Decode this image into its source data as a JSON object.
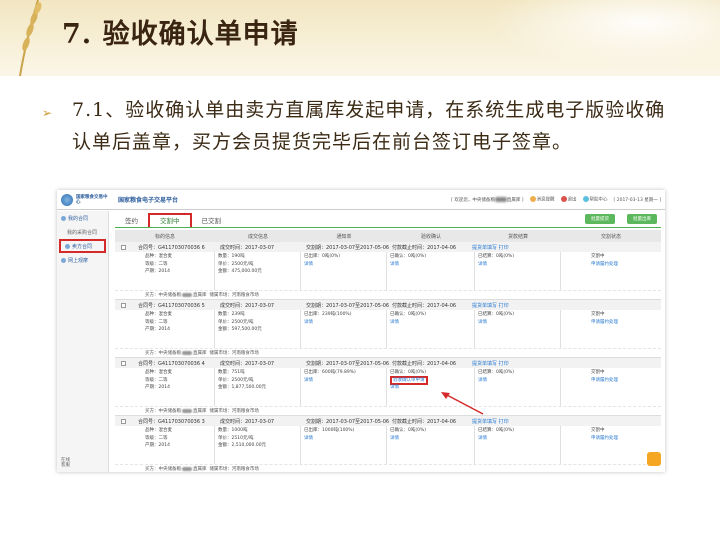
{
  "slide": {
    "title": "7. 验收确认单申请",
    "bullet": "7.1、验收确认单由卖方直属库发起申请，在系统生成电子版验收确认单后盖章，买方会员提货完毕后在前台签订电子签章。"
  },
  "app": {
    "logo_text": "国家粮食交易中心",
    "site_title": "国家粮食电子交易平台",
    "welcome_prefix": "[ 欢迎您，中央储备粮",
    "welcome_suffix": "直属库 ]",
    "messages": "消息提醒",
    "logout": "退出",
    "help": "帮助中心",
    "date": "[ 2017-03-13 星期一 ]"
  },
  "sidebar": {
    "items": [
      {
        "label": "我的合同"
      },
      {
        "label": "我的采购合同"
      },
      {
        "label": "卖方合同"
      },
      {
        "label": "网上观摩"
      }
    ],
    "footer": "在线客服"
  },
  "tabs": [
    {
      "label": "签约"
    },
    {
      "label": "交割中"
    },
    {
      "label": "已交割"
    }
  ],
  "buttons": {
    "btn1": "批量提货",
    "btn2": "批量出库"
  },
  "columns": [
    "标的信息",
    "成交信息",
    "通知单",
    "验收确认",
    "货款结算",
    "交割状态"
  ],
  "orders": [
    {
      "contract": "合同号：G411703070036 6",
      "deal_time": "成交时间：2017-03-07",
      "period": "交割期：2017-03-07至2017-05-06",
      "confirm_time": "付款截止时间：2017-04-06",
      "apply_link": "提货单填写",
      "print_link": "打印",
      "variety": "品种：混合麦",
      "grade": "等级：二等",
      "year": "产期：2014",
      "qty": "数量：190吨",
      "price": "单价：2500元/吨",
      "amount": "金额：475,000.00元",
      "notice": "已出库：0吨(0%)",
      "notice_link": "详情",
      "accept": "已确认：0吨(0%)",
      "accept_link": "详情",
      "pay": "已结算：0吨(0%)",
      "pay_link": "详情",
      "status": "交割中",
      "status_link": "申请履约处理",
      "seller": "买方：中央储备粮",
      "seller2": "直属库",
      "market": "储属市场：河南粮食市场"
    },
    {
      "contract": "合同号：G411703070036 5",
      "deal_time": "成交时间：2017-03-07",
      "period": "交割期：2017-03-07至2017-05-06",
      "confirm_time": "付款截止时间：2017-04-06",
      "apply_link": "提货单填写",
      "print_link": "打印",
      "variety": "品种：混合麦",
      "grade": "等级：二等",
      "year": "产期：2014",
      "qty": "数量：239吨",
      "price": "单价：2500元/吨",
      "amount": "金额：597,500.00元",
      "notice": "已出库：239吨(100%)",
      "notice_link": "详情",
      "accept": "已确认：0吨(0%)",
      "accept_link": "详情",
      "pay": "已结算：0吨(0%)",
      "pay_link": "详情",
      "status": "交割中",
      "status_link": "申请履约处理",
      "seller": "买方：中央储备粮",
      "seller2": "直属库",
      "market": "储属市场：河南粮食市场"
    },
    {
      "contract": "合同号：G411703070036 4",
      "deal_time": "成交时间：2017-03-07",
      "period": "交割期：2017-03-07至2017-05-06",
      "confirm_time": "付款截止时间：2017-04-06",
      "apply_link": "提货单填写",
      "print_link": "打印",
      "variety": "品种：混合麦",
      "grade": "等级：二等",
      "year": "产期：2014",
      "qty": "数量：751吨",
      "price": "单价：2500元/吨",
      "amount": "金额：1,877,500.00元",
      "notice": "已出库：600吨(79.89%)",
      "notice_link": "详情",
      "accept": "已确认：0吨(0%)",
      "accept_link": "验收确认单申请",
      "accept_link2": "详情",
      "pay": "已结算：0吨(0%)",
      "pay_link": "详情",
      "status": "交割中",
      "status_link": "申请履约处理",
      "seller": "买方：中央储备粮",
      "seller2": "直属库",
      "market": "储属市场：河南粮食市场"
    },
    {
      "contract": "合同号：G411703070036 3",
      "deal_time": "成交时间：2017-03-07",
      "period": "交割期：2017-03-07至2017-05-06",
      "confirm_time": "付款截止时间：2017-04-06",
      "apply_link": "提货单填写",
      "print_link": "打印",
      "variety": "品种：混合麦",
      "grade": "等级：二等",
      "year": "产期：2014",
      "qty": "数量：1000吨",
      "price": "单价：2510元/吨",
      "amount": "金额：2,510,000.00元",
      "notice": "已出库：1000吨(100%)",
      "notice_link": "详情",
      "accept": "已确认：0吨(0%)",
      "accept_link": "详情",
      "pay": "已结算：0吨(0%)",
      "pay_link": "详情",
      "status": "交割中",
      "status_link": "申请履约处理",
      "seller": "买方：中央储备粮",
      "seller2": "直属库",
      "market": "储属市场：河南粮食市场"
    }
  ]
}
